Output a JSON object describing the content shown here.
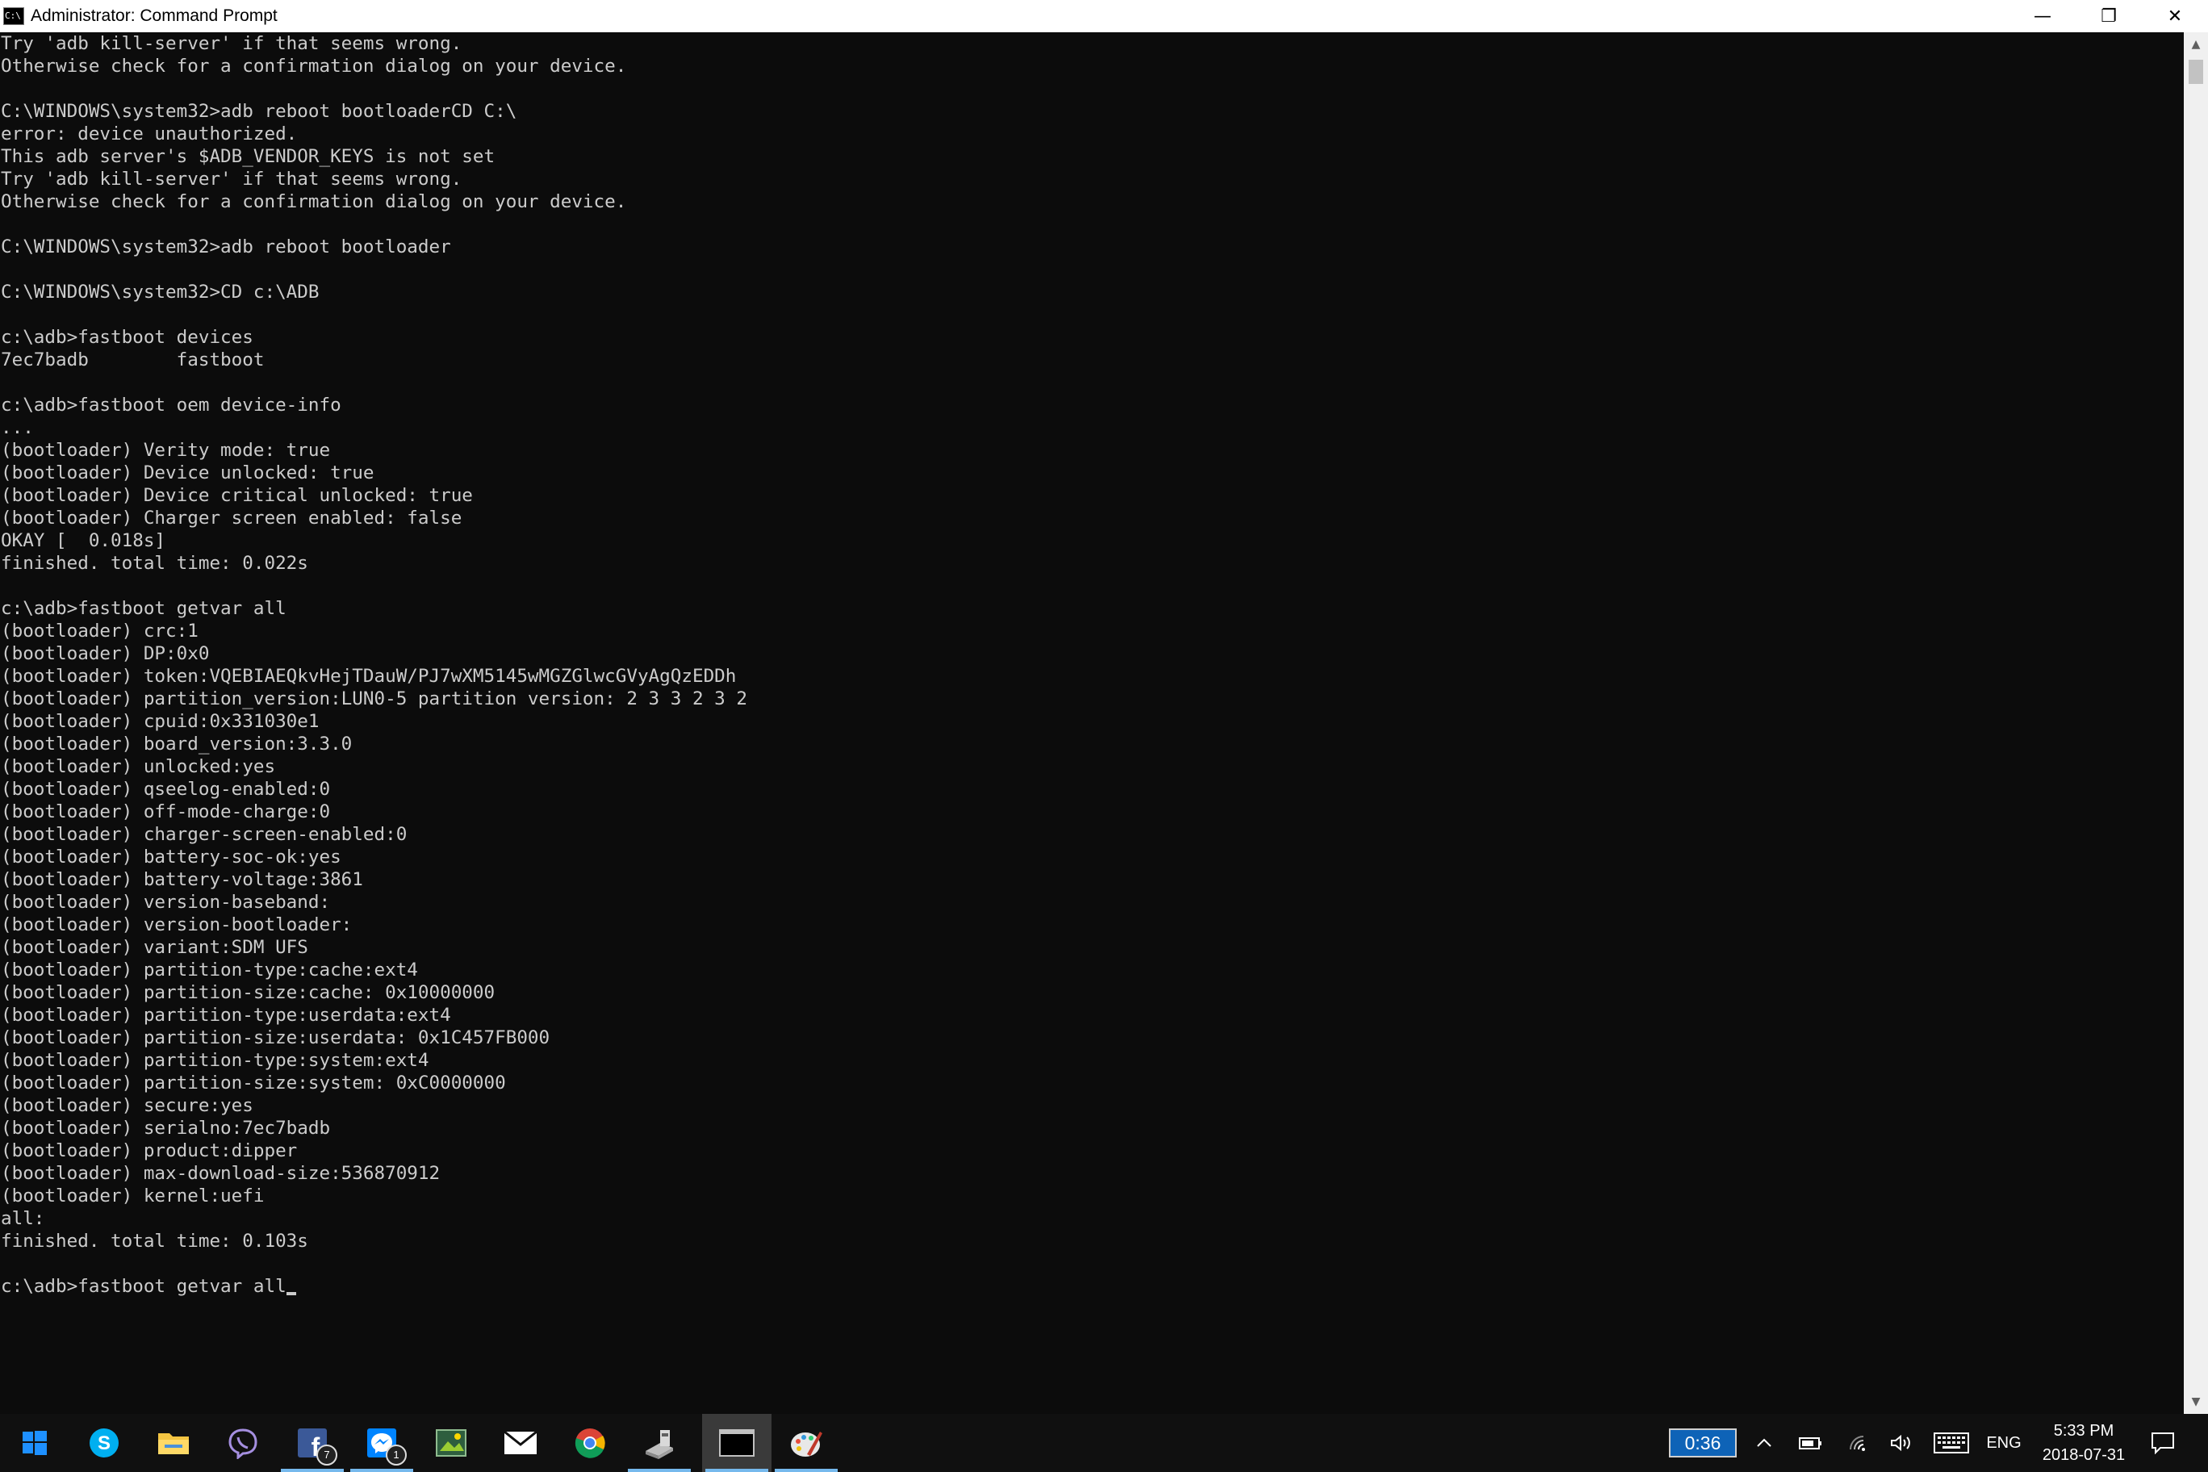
{
  "window": {
    "title": "Administrator: Command Prompt",
    "app_icon_text": "C:\\",
    "minimize_glyph": "—",
    "restore_glyph": "❐",
    "close_glyph": "✕"
  },
  "console": {
    "lines": [
      "Try 'adb kill-server' if that seems wrong.",
      "Otherwise check for a confirmation dialog on your device.",
      "",
      "C:\\WINDOWS\\system32>adb reboot bootloaderCD C:\\",
      "error: device unauthorized.",
      "This adb server's $ADB_VENDOR_KEYS is not set",
      "Try 'adb kill-server' if that seems wrong.",
      "Otherwise check for a confirmation dialog on your device.",
      "",
      "C:\\WINDOWS\\system32>adb reboot bootloader",
      "",
      "C:\\WINDOWS\\system32>CD c:\\ADB",
      "",
      "c:\\adb>fastboot devices",
      "7ec7badb        fastboot",
      "",
      "c:\\adb>fastboot oem device-info",
      "...",
      "(bootloader) Verity mode: true",
      "(bootloader) Device unlocked: true",
      "(bootloader) Device critical unlocked: true",
      "(bootloader) Charger screen enabled: false",
      "OKAY [  0.018s]",
      "finished. total time: 0.022s",
      "",
      "c:\\adb>fastboot getvar all",
      "(bootloader) crc:1",
      "(bootloader) DP:0x0",
      "(bootloader) token:VQEBIAEQkvHejTDauW/PJ7wXM5145wMGZGlwcGVyAgQzEDDh",
      "(bootloader) partition_version:LUN0-5 partition version: 2 3 3 2 3 2",
      "(bootloader) cpuid:0x331030e1",
      "(bootloader) board_version:3.3.0",
      "(bootloader) unlocked:yes",
      "(bootloader) qseelog-enabled:0",
      "(bootloader) off-mode-charge:0",
      "(bootloader) charger-screen-enabled:0",
      "(bootloader) battery-soc-ok:yes",
      "(bootloader) battery-voltage:3861",
      "(bootloader) version-baseband:",
      "(bootloader) version-bootloader:",
      "(bootloader) variant:SDM UFS",
      "(bootloader) partition-type:cache:ext4",
      "(bootloader) partition-size:cache: 0x10000000",
      "(bootloader) partition-type:userdata:ext4",
      "(bootloader) partition-size:userdata: 0x1C457FB000",
      "(bootloader) partition-type:system:ext4",
      "(bootloader) partition-size:system: 0xC0000000",
      "(bootloader) secure:yes",
      "(bootloader) serialno:7ec7badb",
      "(bootloader) product:dipper",
      "(bootloader) max-download-size:536870912",
      "(bootloader) kernel:uefi",
      "all:",
      "finished. total time: 0.103s",
      ""
    ],
    "prompt": "c:\\adb>fastboot getvar all"
  },
  "scrollbar": {
    "up_glyph": "▲",
    "down_glyph": "▼"
  },
  "taskbar": {
    "icons": [
      {
        "name": "start-windows-icon",
        "badge": ""
      },
      {
        "name": "skype-icon",
        "badge": ""
      },
      {
        "name": "file-explorer-icon",
        "badge": ""
      },
      {
        "name": "viber-icon",
        "badge": ""
      },
      {
        "name": "facebook-icon",
        "badge": "7"
      },
      {
        "name": "messenger-icon",
        "badge": "1"
      },
      {
        "name": "photos-app-icon",
        "badge": ""
      },
      {
        "name": "mail-icon",
        "badge": ""
      },
      {
        "name": "chrome-icon",
        "badge": ""
      },
      {
        "name": "usb-tool-icon",
        "badge": ""
      },
      {
        "name": "command-prompt-icon",
        "badge": ""
      },
      {
        "name": "paint-icon",
        "badge": ""
      }
    ],
    "timer": "0:36",
    "tray_chevron": "^",
    "language": "ENG",
    "time": "5:33 PM",
    "date": "2018-07-31",
    "colors": {
      "accent": "#0e63b7",
      "running_indicator": "#76b9ed"
    }
  }
}
